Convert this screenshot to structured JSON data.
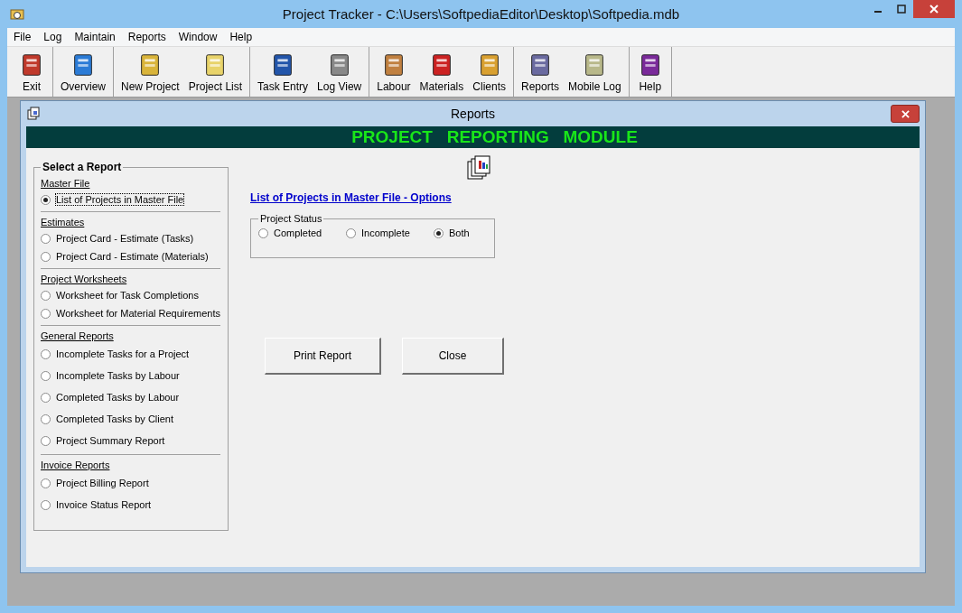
{
  "window": {
    "title": "Project Tracker - C:\\Users\\SoftpediaEditor\\Desktop\\Softpedia.mdb"
  },
  "menu": [
    "File",
    "Log",
    "Maintain",
    "Reports",
    "Window",
    "Help"
  ],
  "toolbar": [
    [
      {
        "label": "Exit"
      }
    ],
    [
      {
        "label": "Overview"
      }
    ],
    [
      {
        "label": "New Project"
      },
      {
        "label": "Project List"
      }
    ],
    [
      {
        "label": "Task Entry"
      },
      {
        "label": "Log View"
      }
    ],
    [
      {
        "label": "Labour"
      },
      {
        "label": "Materials"
      },
      {
        "label": "Clients"
      }
    ],
    [
      {
        "label": "Reports"
      },
      {
        "label": "Mobile Log"
      }
    ],
    [
      {
        "label": "Help"
      }
    ]
  ],
  "child_window": {
    "title": "Reports",
    "banner": "PROJECT   REPORTING   MODULE",
    "report_list": {
      "title": "Select a Report",
      "sections": [
        {
          "title": "Master File",
          "items": [
            {
              "label": "List of Projects in Master File",
              "selected": true
            }
          ]
        },
        {
          "title": "Estimates",
          "items": [
            {
              "label": "Project Card - Estimate (Tasks)",
              "selected": false
            },
            {
              "label": "Project Card - Estimate (Materials)",
              "selected": false
            }
          ]
        },
        {
          "title": "Project Worksheets",
          "items": [
            {
              "label": "Worksheet for Task Completions",
              "selected": false
            },
            {
              "label": "Worksheet for Material Requirements",
              "selected": false
            }
          ]
        },
        {
          "title": "General Reports",
          "items": [
            {
              "label": "Incomplete Tasks for a Project",
              "selected": false
            },
            {
              "label": "Incomplete Tasks by Labour",
              "selected": false
            },
            {
              "label": "Completed Tasks by Labour",
              "selected": false
            },
            {
              "label": "Completed Tasks by Client",
              "selected": false
            },
            {
              "label": "Project Summary Report",
              "selected": false
            }
          ]
        },
        {
          "title": "Invoice Reports",
          "items": [
            {
              "label": "Project Billing Report",
              "selected": false
            },
            {
              "label": "Invoice Status Report",
              "selected": false
            }
          ]
        }
      ]
    },
    "options_title": "List of Projects in Master File - Options",
    "project_status": {
      "title": "Project Status",
      "options": [
        {
          "label": "Completed",
          "selected": false
        },
        {
          "label": "Incomplete",
          "selected": false
        },
        {
          "label": "Both",
          "selected": true
        }
      ]
    },
    "buttons": [
      "Print Report",
      "Close"
    ]
  }
}
